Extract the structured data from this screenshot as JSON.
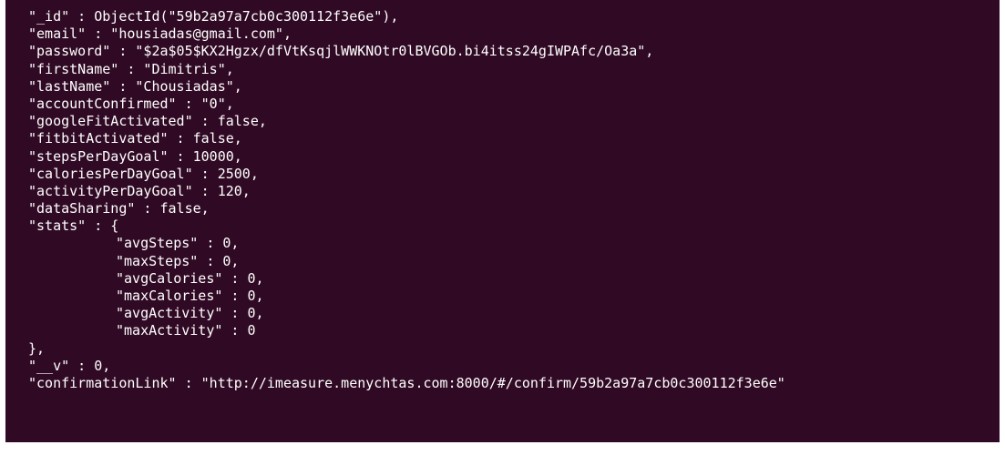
{
  "terminal": {
    "background": "#300a24",
    "foreground": "#ffffff",
    "lines": [
      {
        "indent": false,
        "text": "\"_id\" : ObjectId(\"59b2a97a7cb0c300112f3e6e\"),"
      },
      {
        "indent": false,
        "text": "\"email\" : \"housiadas@gmail.com\","
      },
      {
        "indent": false,
        "text": "\"password\" : \"$2a$05$KX2Hgzx/dfVtKsqjlWWKNOtr0lBVGOb.bi4itss24gIWPAfc/Oa3a\","
      },
      {
        "indent": false,
        "text": "\"firstName\" : \"Dimitris\","
      },
      {
        "indent": false,
        "text": "\"lastName\" : \"Chousiadas\","
      },
      {
        "indent": false,
        "text": "\"accountConfirmed\" : \"0\","
      },
      {
        "indent": false,
        "text": "\"googleFitActivated\" : false,"
      },
      {
        "indent": false,
        "text": "\"fitbitActivated\" : false,"
      },
      {
        "indent": false,
        "text": "\"stepsPerDayGoal\" : 10000,"
      },
      {
        "indent": false,
        "text": "\"caloriesPerDayGoal\" : 2500,"
      },
      {
        "indent": false,
        "text": "\"activityPerDayGoal\" : 120,"
      },
      {
        "indent": false,
        "text": "\"dataSharing\" : false,"
      },
      {
        "indent": false,
        "text": "\"stats\" : {"
      },
      {
        "indent": true,
        "text": "\"avgSteps\" : 0,"
      },
      {
        "indent": true,
        "text": "\"maxSteps\" : 0,"
      },
      {
        "indent": true,
        "text": "\"avgCalories\" : 0,"
      },
      {
        "indent": true,
        "text": "\"maxCalories\" : 0,"
      },
      {
        "indent": true,
        "text": "\"avgActivity\" : 0,"
      },
      {
        "indent": true,
        "text": "\"maxActivity\" : 0"
      },
      {
        "indent": false,
        "text": "},"
      },
      {
        "indent": false,
        "text": "\"__v\" : 0,"
      },
      {
        "indent": false,
        "text": "\"confirmationLink\" : \"http://imeasure.menychtas.com:8000/#/confirm/59b2a97a7cb0c300112f3e6e\""
      }
    ]
  }
}
